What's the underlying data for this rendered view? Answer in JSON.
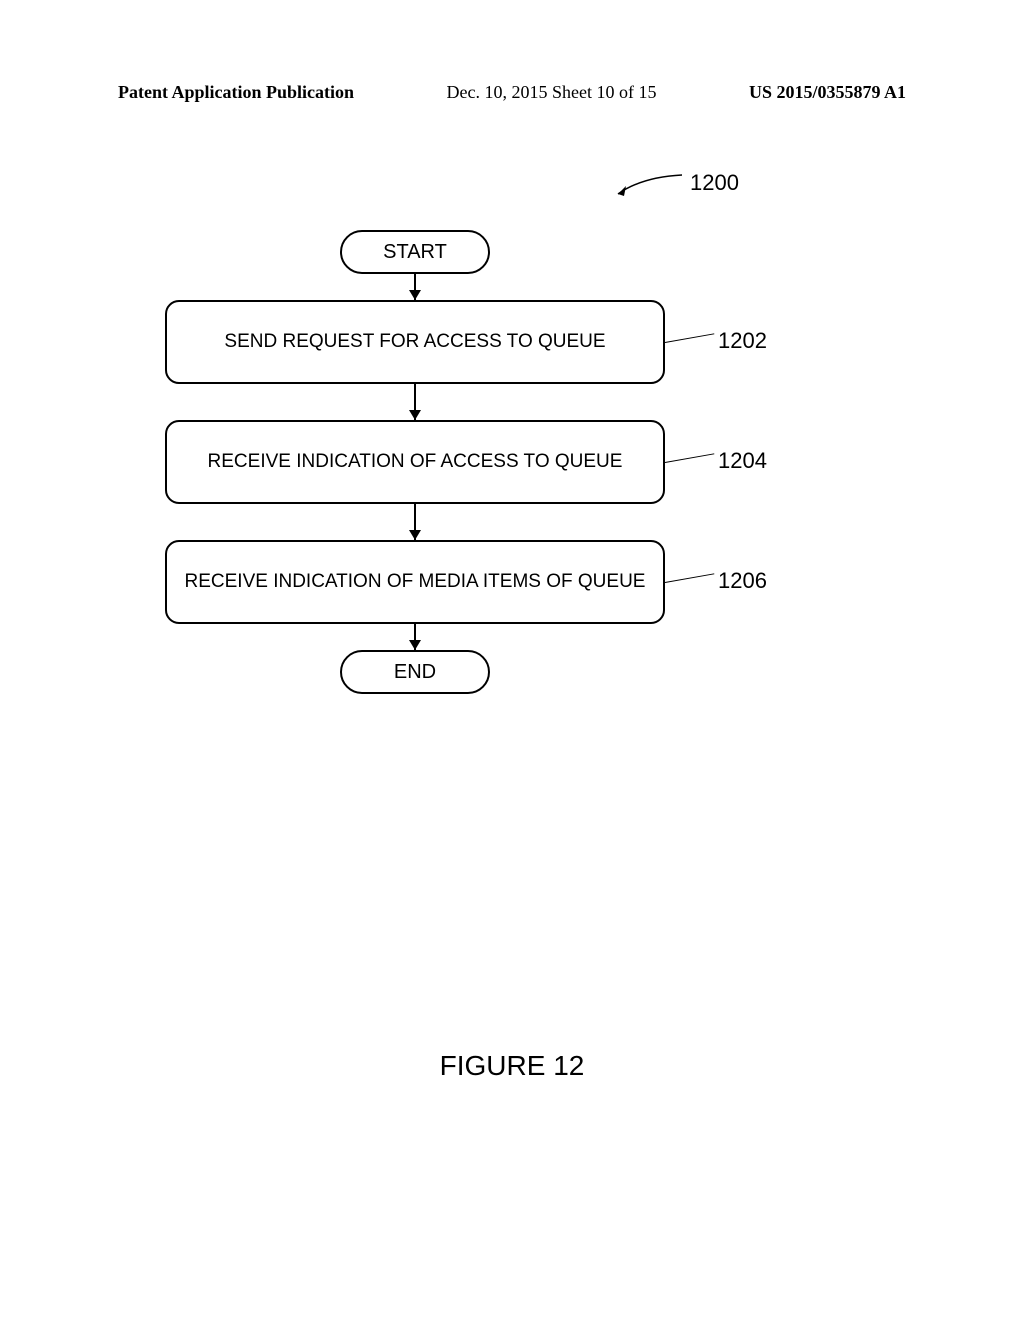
{
  "header": {
    "publication": "Patent Application Publication",
    "date_sheet": "Dec. 10, 2015  Sheet 10 of 15",
    "pub_number": "US 2015/0355879 A1"
  },
  "flowchart": {
    "ref_overall": "1200",
    "start": "START",
    "end": "END",
    "steps": [
      {
        "text": "SEND REQUEST FOR ACCESS TO QUEUE",
        "ref": "1202"
      },
      {
        "text": "RECEIVE INDICATION OF ACCESS TO QUEUE",
        "ref": "1204"
      },
      {
        "text": "RECEIVE INDICATION OF MEDIA ITEMS OF QUEUE",
        "ref": "1206"
      }
    ]
  },
  "figure_label": "FIGURE 12"
}
